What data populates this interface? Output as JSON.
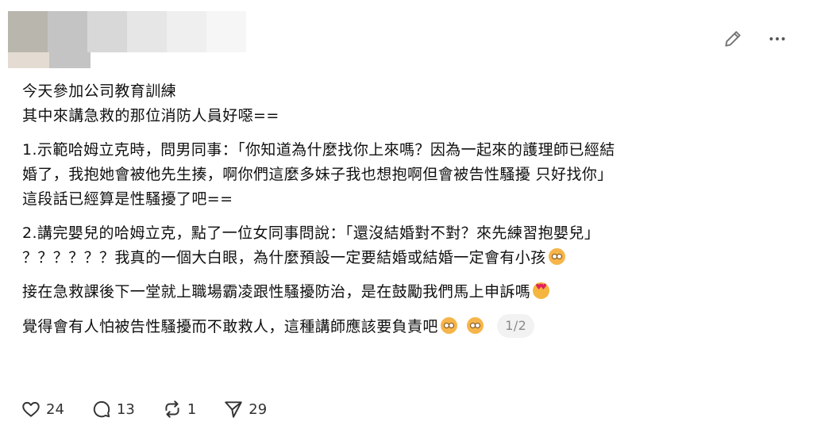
{
  "post": {
    "paragraphs": [
      {
        "lines": [
          "今天參加公司教育訓練",
          "其中來講急救的那位消防人員好噁=="
        ]
      },
      {
        "lines": [
          "1.示範哈姆立克時，問男同事：「你知道為什麼找你上來嗎？因為一起來的護理師已經結",
          "婚了，我抱她會被他先生揍，啊你們這麼多妹子我也想抱啊但會被告性騷擾 只好找你」",
          "這段話已經算是性騷擾了吧=="
        ]
      },
      {
        "lines": [
          "2.講完嬰兒的哈姆立克，點了一位女同事問說：「還沒結婚對不對？來先練習抱嬰兒」",
          "？？？？？？我真的一個大白眼，為什麼預設一定要結婚或結婚一定會有小孩"
        ]
      },
      {
        "lines": [
          "接在急救課後下一堂就上職場霸凌跟性騷擾防治，是在鼓勵我們馬上申訴嗎"
        ]
      },
      {
        "lines": [
          "覺得會有人怕被告性騷擾而不敢救人，這種講師應該要負責吧"
        ]
      }
    ],
    "page_indicator": "1/2"
  },
  "actions": {
    "likes": "24",
    "comments": "13",
    "reposts": "1",
    "shares": "29"
  },
  "icons": {
    "edit": "pencil-icon",
    "more": "more-horizontal-icon",
    "like": "heart-icon",
    "comment": "comment-bubble-icon",
    "repost": "repost-icon",
    "share": "send-icon",
    "emoji_flushed": "flushed-face-emoji",
    "emoji_heart_eyes": "heart-eyes-emoji"
  }
}
